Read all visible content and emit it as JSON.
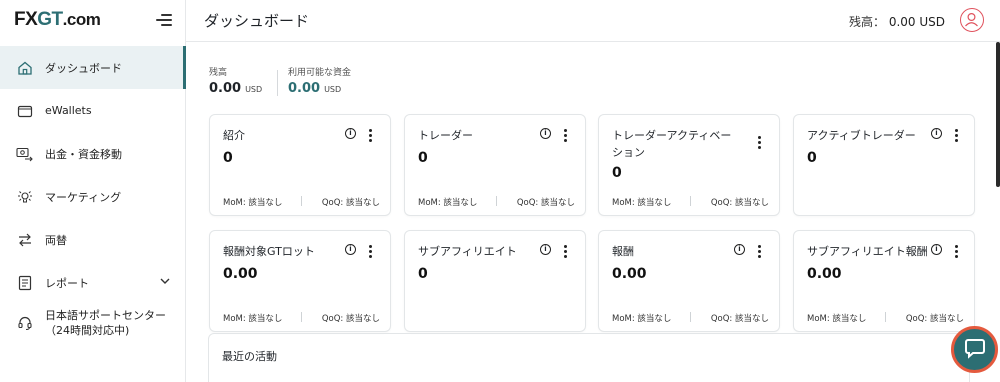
{
  "brand": {
    "logo_fx": "FX",
    "logo_gt": "GT",
    "logo_dom": ".com",
    "accent": "#2c6e73"
  },
  "sidebar": {
    "items": [
      {
        "label": "ダッシュボード",
        "icon": "home-icon",
        "active": true
      },
      {
        "label": "eWallets",
        "icon": "wallet-icon",
        "active": false
      },
      {
        "label": "出金・資金移動",
        "icon": "money-transfer-icon",
        "active": false
      },
      {
        "label": "マーケティング",
        "icon": "marketing-icon",
        "active": false
      },
      {
        "label": "両替",
        "icon": "exchange-icon",
        "active": false
      },
      {
        "label": "レポート",
        "icon": "report-icon",
        "active": false
      },
      {
        "label": "日本語サポートセンター\n（24時間対応中)",
        "icon": "headset-icon",
        "active": false
      }
    ]
  },
  "header": {
    "title": "ダッシュボード",
    "balance_label": "残高：",
    "balance_value": "0.00 USD"
  },
  "balances": {
    "balance_label": "残高",
    "balance_value": "0.00",
    "balance_currency": "USD",
    "available_label": "利用可能な資金",
    "available_value": "0.00",
    "available_currency": "USD"
  },
  "cards": [
    {
      "title": "紹介",
      "value": "0",
      "mom": "MoM: 該当なし",
      "qoq": "QoQ: 該当なし",
      "has_info": true
    },
    {
      "title": "トレーダー",
      "value": "0",
      "mom": "MoM: 該当なし",
      "qoq": "QoQ: 該当なし",
      "has_info": true
    },
    {
      "title": "トレーダーアクティベーション",
      "value": "0",
      "mom": "MoM: 該当なし",
      "qoq": "QoQ: 該当なし",
      "has_info": false
    },
    {
      "title": "アクティブトレーダー",
      "value": "0",
      "mom": "",
      "qoq": "",
      "has_info": true
    },
    {
      "title": "報酬対象GTロット",
      "value": "0.00",
      "mom": "MoM: 該当なし",
      "qoq": "QoQ: 該当なし",
      "has_info": true
    },
    {
      "title": "サブアフィリエイト",
      "value": "0",
      "mom": "",
      "qoq": "",
      "has_info": true
    },
    {
      "title": "報酬",
      "value": "0.00",
      "mom": "MoM: 該当なし",
      "qoq": "QoQ: 該当なし",
      "has_info": true
    },
    {
      "title": "サブアフィリエイト報酬",
      "value": "0.00",
      "mom": "MoM: 該当なし",
      "qoq": "QoQ: 該当なし",
      "has_info": true
    }
  ],
  "activity": {
    "title": "最近の活動"
  },
  "colors": {
    "chat_bg": "#2c6e73",
    "chat_ring": "#e45a3e",
    "avatar_ring": "#e0525d",
    "active_nav_bg": "#eaf1f3"
  }
}
